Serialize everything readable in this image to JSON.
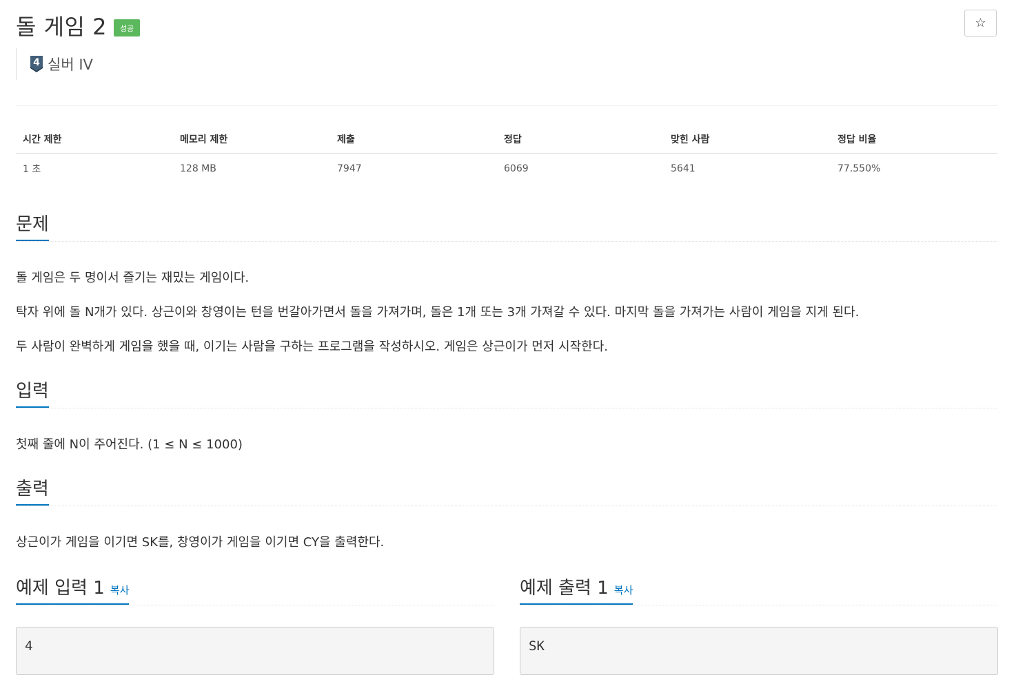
{
  "problem": {
    "title": "돌 게임 2",
    "status_badge": "성공",
    "star_icon": "☆",
    "tier": {
      "number": "4",
      "label": "실버 IV",
      "color": "#435f7a"
    }
  },
  "info_table": {
    "headers": [
      "시간 제한",
      "메모리 제한",
      "제출",
      "정답",
      "맞힌 사람",
      "정답 비율"
    ],
    "values": [
      "1 초",
      "128 MB",
      "7947",
      "6069",
      "5641",
      "77.550%"
    ]
  },
  "sections": {
    "problem": {
      "heading": "문제",
      "paragraphs": [
        "돌 게임은 두 명이서 즐기는 재밌는 게임이다.",
        "탁자 위에 돌 N개가 있다. 상근이와 창영이는 턴을 번갈아가면서 돌을 가져가며, 돌은 1개 또는 3개 가져갈 수 있다. 마지막 돌을 가져가는 사람이 게임을 지게 된다.",
        "두 사람이 완벽하게 게임을 했을 때, 이기는 사람을 구하는 프로그램을 작성하시오. 게임은 상근이가 먼저 시작한다."
      ]
    },
    "input": {
      "heading": "입력",
      "text": "첫째 줄에 N이 주어진다. (1 ≤ N ≤ 1000)"
    },
    "output": {
      "heading": "출력",
      "text": "상근이가 게임을 이기면 SK를, 창영이가 게임을 이기면 CY을 출력한다."
    }
  },
  "samples": {
    "input": {
      "heading": "예제 입력 1",
      "copy_label": "복사",
      "content": "4"
    },
    "output": {
      "heading": "예제 출력 1",
      "copy_label": "복사",
      "content": "SK"
    }
  },
  "colors": {
    "accent": "#0076c0",
    "success": "#5cb85c"
  }
}
